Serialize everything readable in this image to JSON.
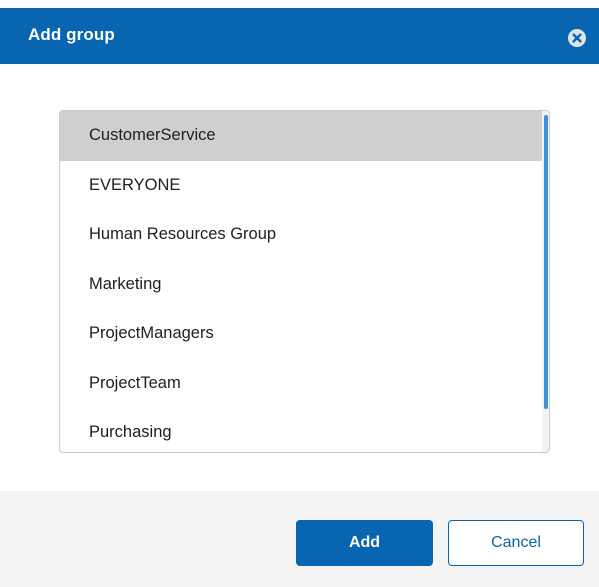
{
  "dialog": {
    "title": "Add group",
    "close_icon": "close-circle-icon"
  },
  "groups": {
    "selected": "CustomerService",
    "items": [
      "CustomerService",
      "EVERYONE",
      "Human Resources Group",
      "Marketing",
      "ProjectManagers",
      "ProjectTeam",
      "Purchasing"
    ]
  },
  "footer": {
    "add_label": "Add",
    "cancel_label": "Cancel"
  },
  "colors": {
    "accent": "#0765b1",
    "selected_row": "#cfcfcf",
    "scroll_thumb": "#3d8fd8",
    "footer_bg": "#f4f4f4"
  }
}
